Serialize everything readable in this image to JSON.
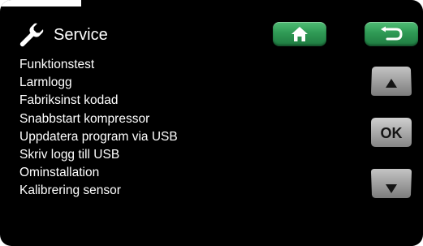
{
  "header": {
    "title": "Service",
    "icon": "wrench-icon",
    "home_icon": "home-icon",
    "back_icon": "back-arrow-icon",
    "nav_button_color": "#2f9a55"
  },
  "menu": {
    "items": [
      {
        "label": "Funktionstest"
      },
      {
        "label": "Larmlogg"
      },
      {
        "label": "Fabriksinst kodad"
      },
      {
        "label": "Snabbstart kompressor"
      },
      {
        "label": "Uppdatera program via USB"
      },
      {
        "label": "Skriv logg till USB"
      },
      {
        "label": "Ominstallation"
      },
      {
        "label": "Kalibrering sensor"
      }
    ]
  },
  "controls": {
    "up_icon": "arrow-up-icon",
    "ok_label": "OK",
    "down_icon": "arrow-down-icon",
    "button_color": "#9a9a9a"
  },
  "colors": {
    "background": "#000000",
    "text": "#ffffff"
  }
}
